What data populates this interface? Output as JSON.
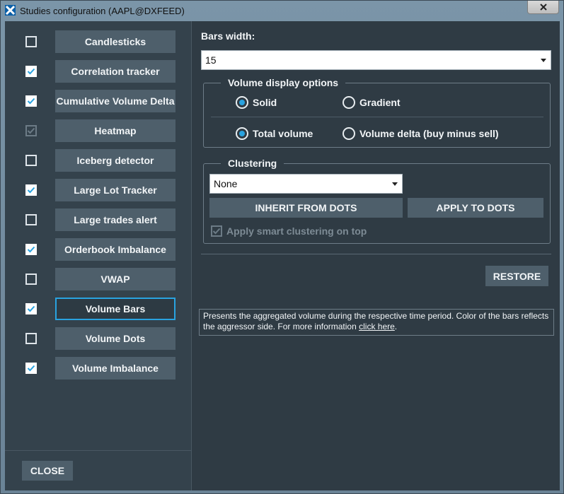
{
  "window": {
    "title": "Studies configuration (AAPL@DXFEED)"
  },
  "studies": [
    {
      "label": "Candlesticks",
      "checked": false,
      "disabled": false,
      "selected": false
    },
    {
      "label": "Correlation tracker",
      "checked": true,
      "disabled": false,
      "selected": false
    },
    {
      "label": "Cumulative Volume Delta",
      "checked": true,
      "disabled": false,
      "selected": false
    },
    {
      "label": "Heatmap",
      "checked": true,
      "disabled": true,
      "selected": false
    },
    {
      "label": "Iceberg detector",
      "checked": false,
      "disabled": false,
      "selected": false
    },
    {
      "label": "Large Lot Tracker",
      "checked": true,
      "disabled": false,
      "selected": false
    },
    {
      "label": "Large trades alert",
      "checked": false,
      "disabled": false,
      "selected": false
    },
    {
      "label": "Orderbook Imbalance",
      "checked": true,
      "disabled": false,
      "selected": false
    },
    {
      "label": "VWAP",
      "checked": false,
      "disabled": false,
      "selected": false
    },
    {
      "label": "Volume Bars",
      "checked": true,
      "disabled": false,
      "selected": true
    },
    {
      "label": "Volume Dots",
      "checked": false,
      "disabled": false,
      "selected": false
    },
    {
      "label": "Volume Imbalance",
      "checked": true,
      "disabled": false,
      "selected": false
    }
  ],
  "footer": {
    "close_label": "CLOSE"
  },
  "settings": {
    "bars_width_label": "Bars width:",
    "bars_width_value": "15",
    "volume_display": {
      "title": "Volume display options",
      "solid_label": "Solid",
      "gradient_label": "Gradient",
      "style_selected": "Solid",
      "total_label": "Total volume",
      "delta_label": "Volume delta (buy minus sell)",
      "mode_selected": "Total volume"
    },
    "clustering": {
      "title": "Clustering",
      "value": "None",
      "inherit_label": "INHERIT FROM DOTS",
      "apply_label": "APPLY TO DOTS",
      "smart_label": "Apply smart clustering on top",
      "smart_checked": true
    },
    "restore_label": "RESTORE",
    "description": {
      "text": "Presents the aggregated volume during the respective time period. Color of the bars reflects the aggressor side. For more information ",
      "link": "click here",
      "suffix": "."
    }
  },
  "colors": {
    "accent": "#29a3e0",
    "button": "#4e5f6b",
    "background": "#2f3b44"
  }
}
